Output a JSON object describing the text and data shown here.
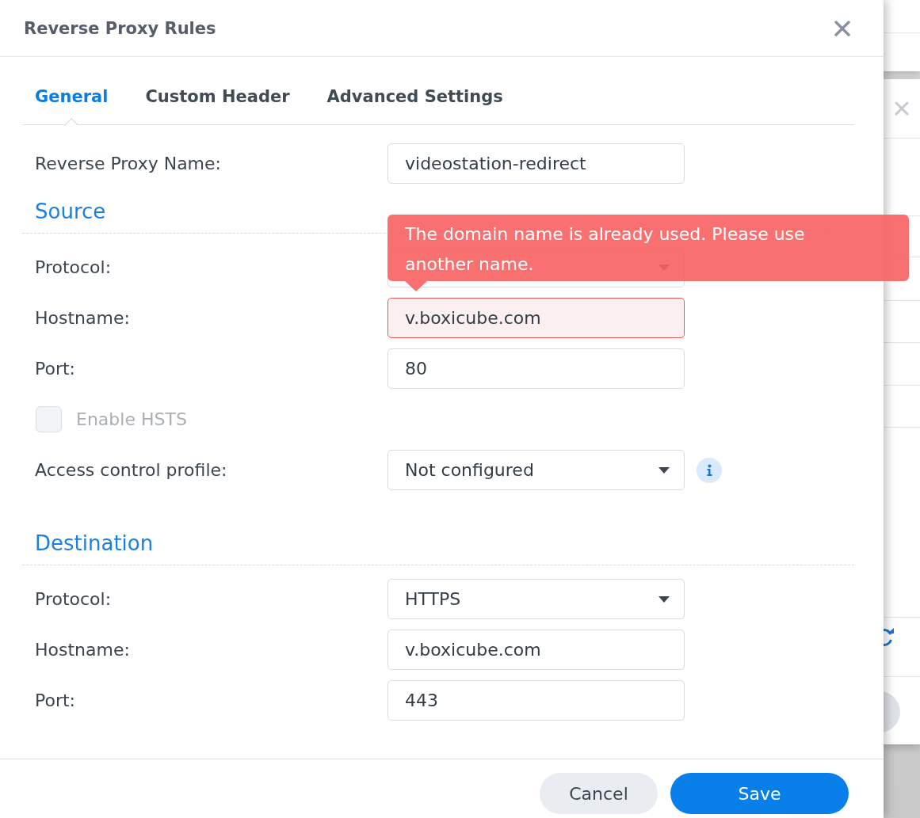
{
  "dialog": {
    "title": "Reverse Proxy Rules"
  },
  "tabs": [
    {
      "label": "General",
      "selected": true
    },
    {
      "label": "Custom Header",
      "selected": false
    },
    {
      "label": "Advanced Settings",
      "selected": false
    }
  ],
  "name_field": {
    "label": "Reverse Proxy Name:",
    "value": "videostation-redirect"
  },
  "sections": [
    {
      "heading": "Source",
      "rows": [
        {
          "kind": "select",
          "label": "Protocol:"
        },
        {
          "kind": "text",
          "label": "Hostname:",
          "value": "v.boxicube.com",
          "error_tooltip": "The domain name is already used. Please use another name."
        },
        {
          "kind": "text",
          "label": "Port:",
          "value": "80"
        },
        {
          "kind": "checkbox",
          "label": "Enable HSTS",
          "checked": false,
          "disabled": true
        },
        {
          "kind": "select",
          "label": "Access control profile:",
          "value": "Not configured",
          "info": true
        }
      ]
    },
    {
      "heading": "Destination",
      "rows": [
        {
          "kind": "select",
          "label": "Protocol:",
          "value": "HTTPS"
        },
        {
          "kind": "text",
          "label": "Hostname:",
          "value": "v.boxicube.com"
        },
        {
          "kind": "text",
          "label": "Port:",
          "value": "443"
        }
      ]
    }
  ],
  "buttons": [
    {
      "label": "Cancel",
      "kind": "secondary"
    },
    {
      "label": "Save",
      "kind": "primary"
    }
  ]
}
